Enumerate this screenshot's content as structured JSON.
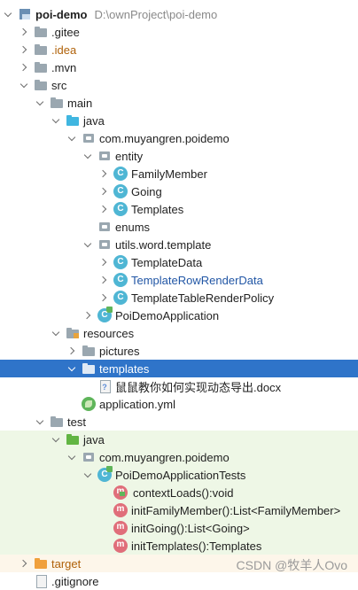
{
  "project": {
    "name": "poi-demo",
    "path": "D:\\ownProject\\poi-demo"
  },
  "tree": {
    "gitee": ".gitee",
    "idea": ".idea",
    "mvn": ".mvn",
    "src": "src",
    "main": "main",
    "java": "java",
    "pkg_main": "com.muyangren.poidemo",
    "entity": "entity",
    "family_member": "FamilyMember",
    "going": "Going",
    "templates_cls": "Templates",
    "enums": "enums",
    "utils": "utils.word.template",
    "template_data": "TemplateData",
    "row_render": "TemplateRowRenderData",
    "table_policy": "TemplateTableRenderPolicy",
    "app": "PoiDemoApplication",
    "resources": "resources",
    "pictures": "pictures",
    "templates_dir": "templates",
    "docx": "鼠鼠教你如何实现动态导出.docx",
    "yml": "application.yml",
    "test": "test",
    "test_java": "java",
    "pkg_test": "com.muyangren.poidemo",
    "tests_cls": "PoiDemoApplicationTests",
    "m1": "contextLoads():void",
    "m2": "initFamilyMember():List<FamilyMember>",
    "m3": "initGoing():List<Going>",
    "m4": "initTemplates():Templates",
    "target": "target",
    "gitignore": ".gitignore"
  },
  "watermark": "CSDN @牧羊人Ovo",
  "colors": {
    "selection": "#2f74c9",
    "test_bg": "#eef7e6",
    "link_blue": "#2156a5"
  }
}
